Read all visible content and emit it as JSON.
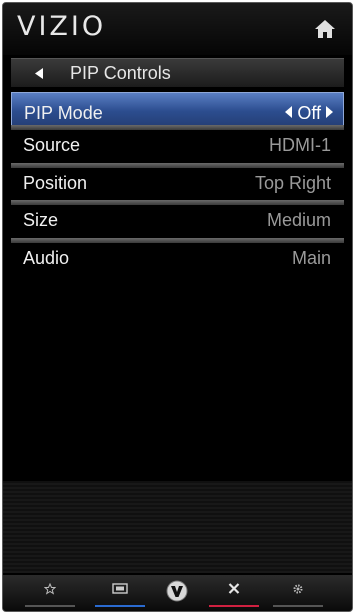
{
  "header": {
    "logo": "VIZIO",
    "home_icon": "home-icon"
  },
  "titlebar": {
    "back_icon": "back-arrow-icon",
    "title": "PIP Controls"
  },
  "menu": {
    "items": [
      {
        "label": "PIP Mode",
        "value": "Off",
        "selected": true
      },
      {
        "label": "Source",
        "value": "HDMI-1",
        "selected": false
      },
      {
        "label": "Position",
        "value": "Top Right",
        "selected": false
      },
      {
        "label": "Size",
        "value": "Medium",
        "selected": false
      },
      {
        "label": "Audio",
        "value": "Main",
        "selected": false
      }
    ]
  },
  "bottombar": {
    "buttons": [
      {
        "icon": "star-icon",
        "color": "#555555"
      },
      {
        "icon": "wide-icon",
        "color": "#2a6ad0"
      },
      {
        "icon": "vizio-v-icon",
        "color": "#000000"
      },
      {
        "icon": "close-icon",
        "color": "#d02040"
      },
      {
        "icon": "gear-icon",
        "color": "#555555"
      }
    ]
  },
  "colors": {
    "selected_row": "#3b5ea8",
    "value_text": "#9a9a9a",
    "background": "#000000"
  }
}
